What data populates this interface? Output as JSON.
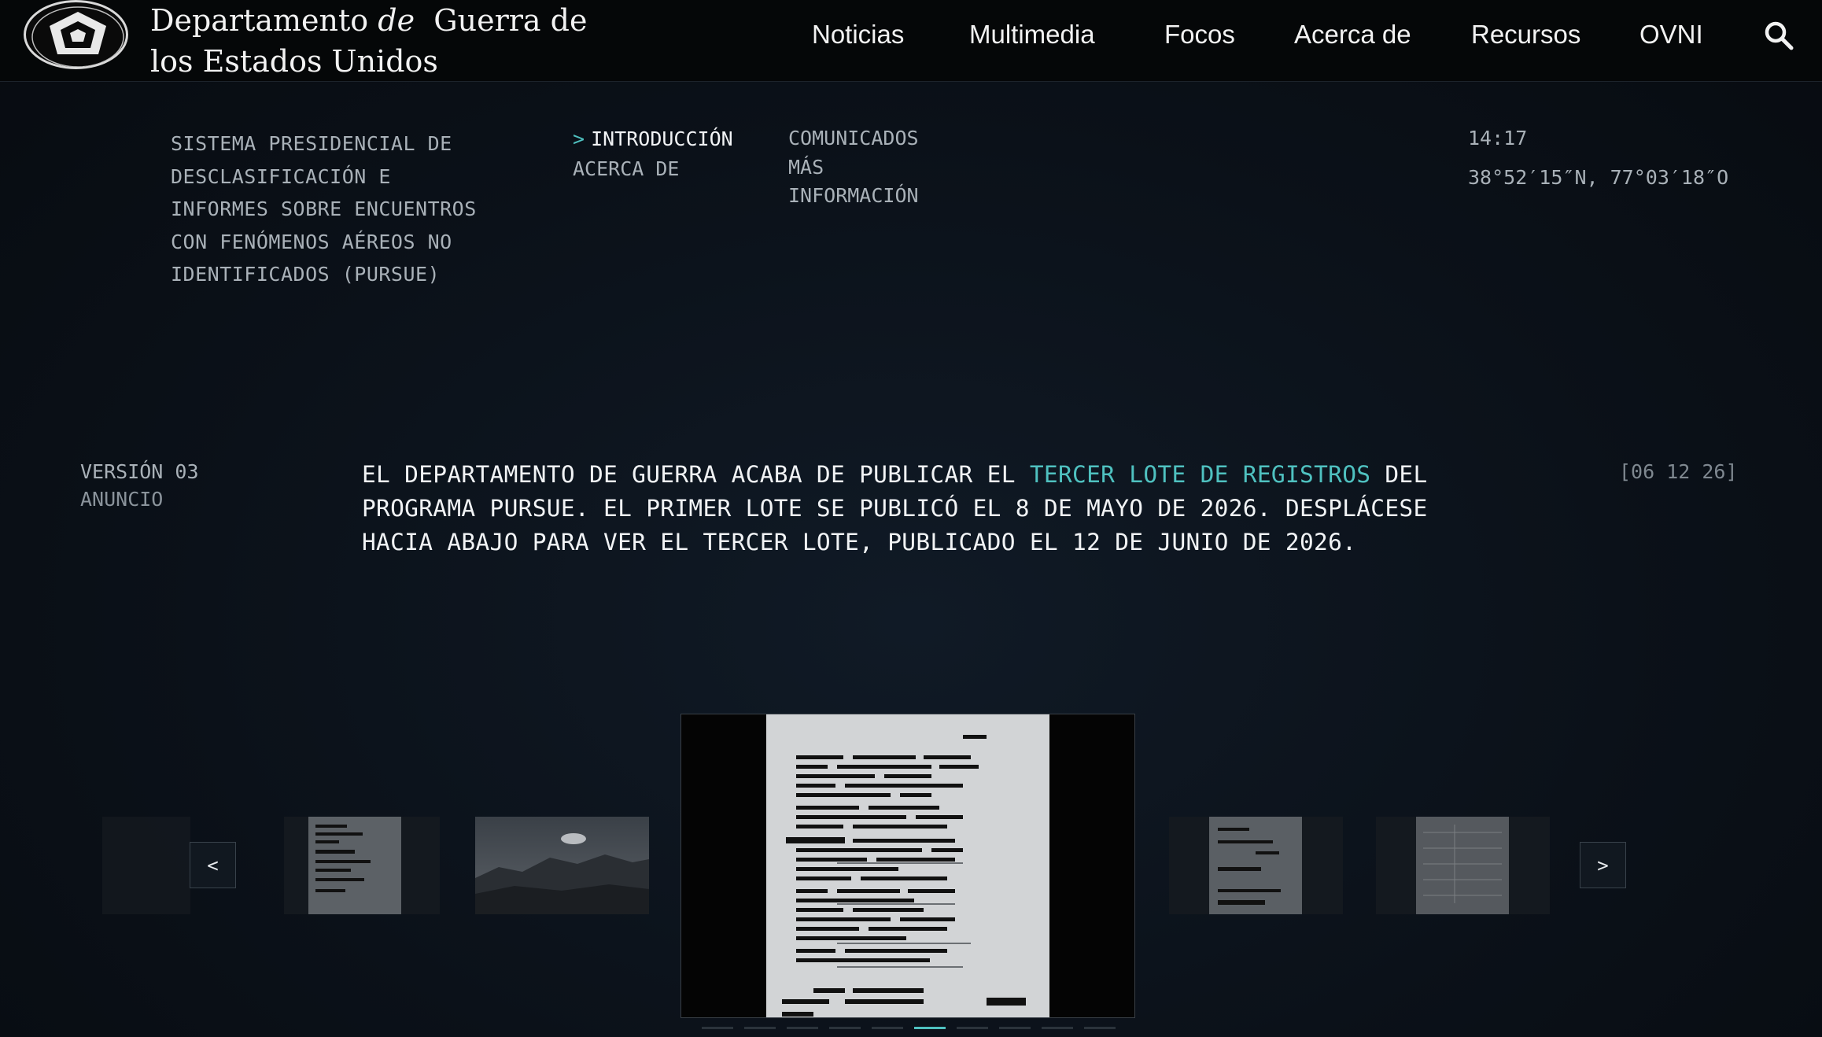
{
  "header": {
    "brand_line1_pre": "Departamento",
    "brand_line1_italic": "de",
    "brand_line1_post": "Guerra de",
    "brand_line2": "los Estados Unidos",
    "nav": [
      "Noticias",
      "Multimedia",
      "Focos",
      "Acerca de",
      "Recursos",
      "OVNI"
    ],
    "search_icon": "search-icon"
  },
  "intro": {
    "system_title_lines": [
      "SISTEMA PRESIDENCIAL DE",
      "DESCLASIFICACIÓN E",
      "INFORMES SOBRE ENCUENTROS",
      "CON FENÓMENOS AÉREOS NO",
      "IDENTIFICADOS (PURSUE)"
    ],
    "menu": {
      "active_marker": ">",
      "active": "INTRODUCCIÓN",
      "about": "ACERCA DE",
      "releases": "COMUNICADOS",
      "more_info_1": "MÁS",
      "more_info_2": "INFORMACIÓN"
    },
    "clock": "14:17",
    "coordinates": "38°52′15″N, 77°03′18″O"
  },
  "announcement": {
    "version": "VERSIÓN 03",
    "label": "ANUNCIO",
    "line1_pre": "EL DEPARTAMENTO DE GUERRA ACABA DE PUBLICAR EL",
    "link": "TERCER LOTE DE REGISTROS",
    "line1_post": "DEL",
    "line2": "PROGRAMA PURSUE. EL PRIMER LOTE SE PUBLICÓ EL 8 DE MAYO DE 2026. DESPLÁCESE",
    "line3": "HACIA ABAJO PARA VER EL TERCER LOTE, PUBLICADO EL 12 DE JUNIO DE 2026.",
    "date_tag": "[06 12 26]"
  },
  "carousel": {
    "prev_label": "<",
    "next_label": ">",
    "slide_count": 10,
    "active_slide": 5
  },
  "colors": {
    "accent": "#4fc1c0",
    "background": "#0b1119",
    "topbar": "#050708"
  }
}
